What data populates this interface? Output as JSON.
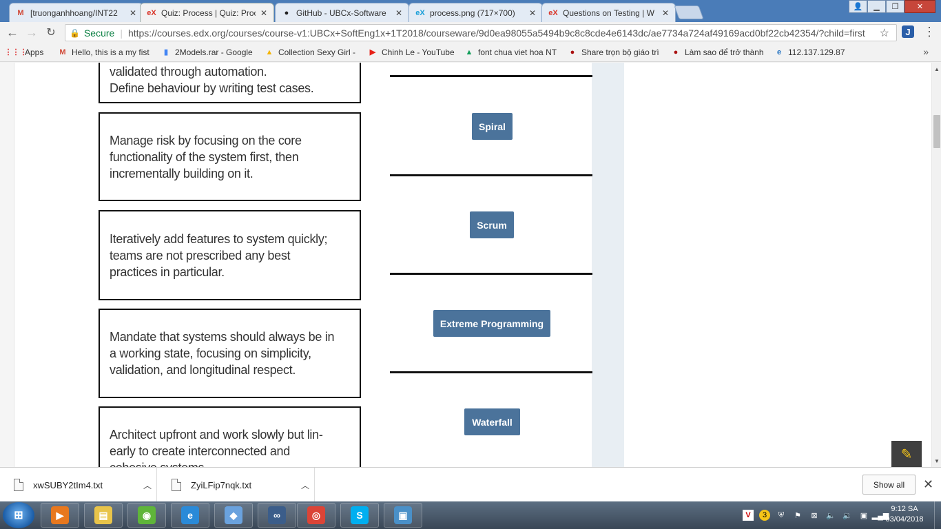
{
  "tabs": [
    {
      "title": "[truonganhhoang/INT22",
      "icon": "gmail-icon",
      "glyph": "M",
      "color": "#d14836"
    },
    {
      "title": "Quiz: Process | Quiz: Proc",
      "icon": "edx-icon",
      "glyph": "eX",
      "color": "#d9372b",
      "active": true
    },
    {
      "title": "GitHub - UBCx-Software",
      "icon": "github-icon",
      "glyph": "●",
      "color": "#222222"
    },
    {
      "title": "process.png (717×700)",
      "icon": "edx-open-icon",
      "glyph": "eX",
      "color": "#1a9fd8"
    },
    {
      "title": "Questions on Testing | W",
      "icon": "edx-icon",
      "glyph": "eX",
      "color": "#d9372b"
    }
  ],
  "address": {
    "secure_label": "Secure",
    "url": "https://courses.edx.org/courses/course-v1:UBCx+SoftEng1x+1T2018/courseware/9d0ea98055a5494b9c8c8cde4e6143dc/ae7734a724af49169acd0bf22cb42354/?child=first"
  },
  "bookmarks": [
    {
      "label": "Apps",
      "icon": "apps-grid-icon",
      "glyph": "⋮⋮⋮",
      "color": "#d33"
    },
    {
      "label": "Hello, this is a my fist",
      "icon": "gmail-icon",
      "glyph": "M",
      "color": "#d14836"
    },
    {
      "label": "2Models.rar - Google",
      "icon": "google-docs-icon",
      "glyph": "▮",
      "color": "#4285f4"
    },
    {
      "label": "Collection Sexy Girl -",
      "icon": "google-drive-icon",
      "glyph": "▲",
      "color": "#f4b400"
    },
    {
      "label": "Chinh Le - YouTube",
      "icon": "youtube-icon",
      "glyph": "▶",
      "color": "#e62117"
    },
    {
      "label": "font chua viet hoa NT",
      "icon": "google-drive-icon",
      "glyph": "▲",
      "color": "#0f9d58"
    },
    {
      "label": "Share trọn bộ giáo trì",
      "icon": "forum-icon",
      "glyph": "●",
      "color": "#a11"
    },
    {
      "label": "Làm sao để trở thành",
      "icon": "forum-icon",
      "glyph": "●",
      "color": "#a11"
    },
    {
      "label": "112.137.129.87",
      "icon": "ie-globe-icon",
      "glyph": "e",
      "color": "#1e6fc0"
    }
  ],
  "matching": {
    "descriptions": [
      {
        "lines": [
          "validated through automation.",
          "Define behaviour by writing test cases."
        ]
      },
      {
        "lines": [
          "Manage risk by focusing on the core",
          "functionality of the system first, then",
          "incrementally building on it."
        ]
      },
      {
        "lines": [
          "Iteratively add features to system quickly;",
          "teams are not prescribed any best",
          "practices in particular."
        ]
      },
      {
        "lines": [
          "Mandate that systems should always be in",
          "a working state, focusing on simplicity,",
          "validation, and longitudinal respect."
        ]
      },
      {
        "lines": [
          "Architect upfront and work slowly but lin-",
          "early to create interconnected and",
          "cohesive systems."
        ]
      }
    ],
    "options": [
      "Spiral",
      "Scrum",
      "Extreme Programming",
      "Waterfall"
    ]
  },
  "downloads": {
    "items": [
      "xwSUBY2tIm4.txt",
      "ZyiLFip7nqk.txt"
    ],
    "show_all": "Show all"
  },
  "taskbar": {
    "time": "9:12 SA",
    "date": "03/04/2018",
    "apps": [
      {
        "name": "media-player-icon",
        "glyph": "▶",
        "color": "#e8781e"
      },
      {
        "name": "file-explorer-icon",
        "glyph": "▤",
        "color": "#e8c44a"
      },
      {
        "name": "coccoc-icon",
        "glyph": "◉",
        "color": "#5fb53a"
      },
      {
        "name": "internet-explorer-icon",
        "glyph": "e",
        "color": "#2a8ad8"
      },
      {
        "name": "virtualbox-icon",
        "glyph": "◆",
        "color": "#6aa2de"
      },
      {
        "name": "visual-studio-icon",
        "glyph": "∞",
        "color": "#3b5d8a"
      },
      {
        "name": "chrome-icon",
        "glyph": "◎",
        "color": "#db4437"
      },
      {
        "name": "skype-icon",
        "glyph": "S",
        "color": "#00aff0"
      },
      {
        "name": "photo-viewer-icon",
        "glyph": "▣",
        "color": "#4a90c8"
      }
    ],
    "tray_badge": "3"
  }
}
